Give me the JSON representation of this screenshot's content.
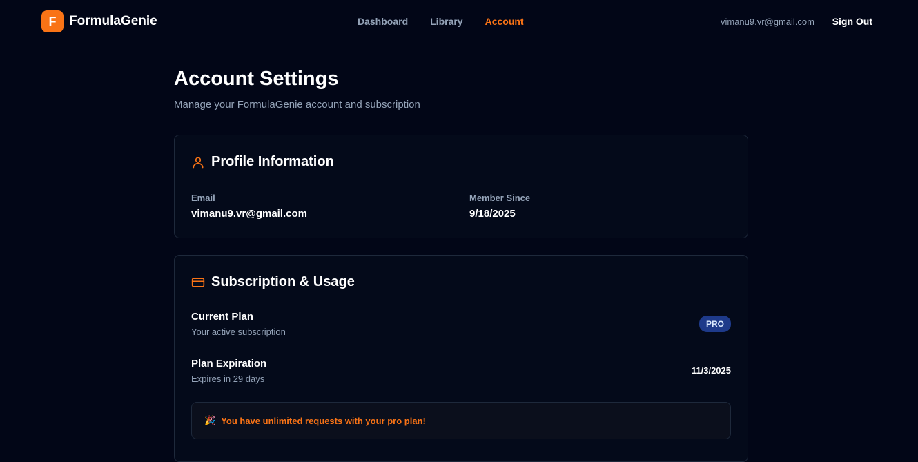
{
  "brand": {
    "logo_letter": "F",
    "name": "FormulaGenie"
  },
  "nav": {
    "items": [
      {
        "label": "Dashboard"
      },
      {
        "label": "Library"
      },
      {
        "label": "Account"
      }
    ],
    "active": "Account"
  },
  "user": {
    "email": "vimanu9.vr@gmail.com",
    "signout_label": "Sign Out"
  },
  "page": {
    "title": "Account Settings",
    "subtitle": "Manage your FormulaGenie account and subscription"
  },
  "profile": {
    "title": "Profile Information",
    "icon": "user-icon",
    "email_label": "Email",
    "email_value": "vimanu9.vr@gmail.com",
    "member_since_label": "Member Since",
    "member_since_value": "9/18/2025"
  },
  "subscription": {
    "title": "Subscription & Usage",
    "icon": "credit-card-icon",
    "current_plan_label": "Current Plan",
    "current_plan_sub": "Your active subscription",
    "plan_badge": "PRO",
    "expiration_label": "Plan Expiration",
    "expiration_sub": "Expires in 29 days",
    "expiration_date": "11/3/2025",
    "notice_icon": "party-popper-icon",
    "notice_text": "You have unlimited requests with your pro plan!"
  },
  "colors": {
    "background": "#020617",
    "accent": "#f97316",
    "badge_bg": "#1e3a8a",
    "muted_text": "#94a3b8"
  }
}
